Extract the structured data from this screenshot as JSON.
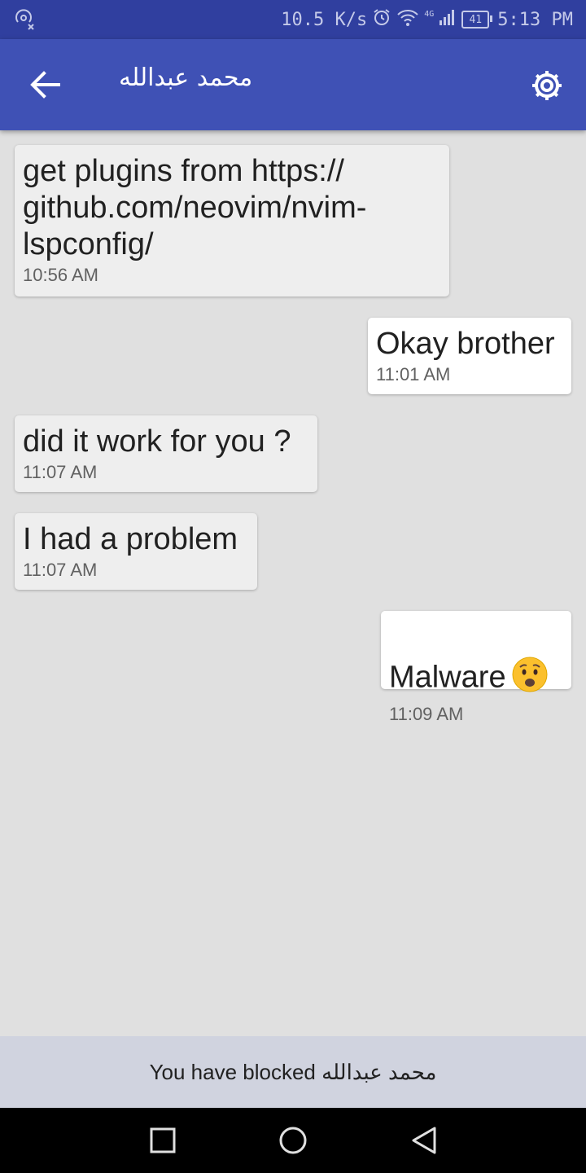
{
  "status_bar": {
    "network_speed": "10.5 K/s",
    "network_type": "4G",
    "battery": "41",
    "time": "5:13 PM"
  },
  "app_bar": {
    "title": "محمد عبدالله"
  },
  "messages": [
    {
      "direction": "incoming",
      "text": "get plugins from https://\ngithub.com/neovim/nvim-\nlspconfig/",
      "time": "10:56 AM"
    },
    {
      "direction": "outgoing",
      "text": "Okay brother",
      "time": "11:01 AM"
    },
    {
      "direction": "incoming",
      "text": "did it work for you ?",
      "time": "11:07 AM"
    },
    {
      "direction": "incoming",
      "text": "I had a problem",
      "time": "11:07 AM"
    },
    {
      "direction": "outgoing",
      "text": "Malware",
      "time": "11:09 AM",
      "emoji": "worried-face-icon"
    }
  ],
  "blocked_notice": {
    "prefix": "You have blocked",
    "name": "محمد عبدالله"
  },
  "colors": {
    "app_bar": "#3f51b5",
    "status_bar": "#303f9f",
    "background": "#e0e0e0",
    "incoming_bubble": "#eeeeee",
    "outgoing_bubble": "#ffffff"
  }
}
